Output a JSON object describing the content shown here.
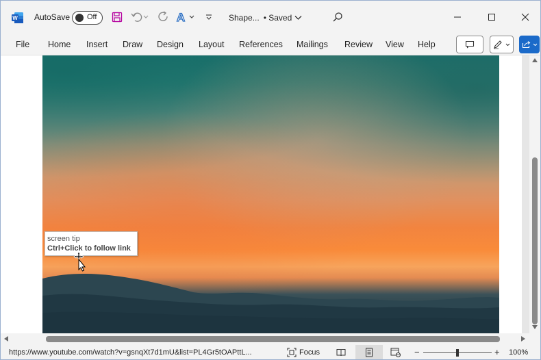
{
  "app": {
    "autosave_label": "AutoSave",
    "autosave_state": "Off",
    "doc_title": "Shape...",
    "doc_status": "• Saved",
    "accent_color": "#1b6ac9"
  },
  "ribbon": {
    "tabs": [
      "File",
      "Home",
      "Insert",
      "Draw",
      "Design",
      "Layout",
      "References",
      "Mailings",
      "Review",
      "View",
      "Help"
    ]
  },
  "screentip": {
    "title": "screen tip",
    "body": "Ctrl+Click to follow link"
  },
  "statusbar": {
    "url": "https://www.youtube.com/watch?v=gsnqXt7d1mU&list=PL4Gr5tOAPttL...",
    "focus_label": "Focus",
    "zoom_minus": "−",
    "zoom_plus": "+",
    "zoom_level": "100%",
    "zoom_fraction": 0.5
  },
  "icons": {
    "word_logo": "word-logo-icon",
    "save": "save-icon",
    "undo": "undo-icon",
    "redo": "redo-icon",
    "font_color": "font-color-icon",
    "customize": "customize-toolbar-icon",
    "search": "search-icon",
    "minimize": "minimize-icon",
    "maximize": "maximize-icon",
    "close": "close-icon",
    "comments": "comments-icon",
    "editing": "pen-icon",
    "share": "share-icon"
  }
}
